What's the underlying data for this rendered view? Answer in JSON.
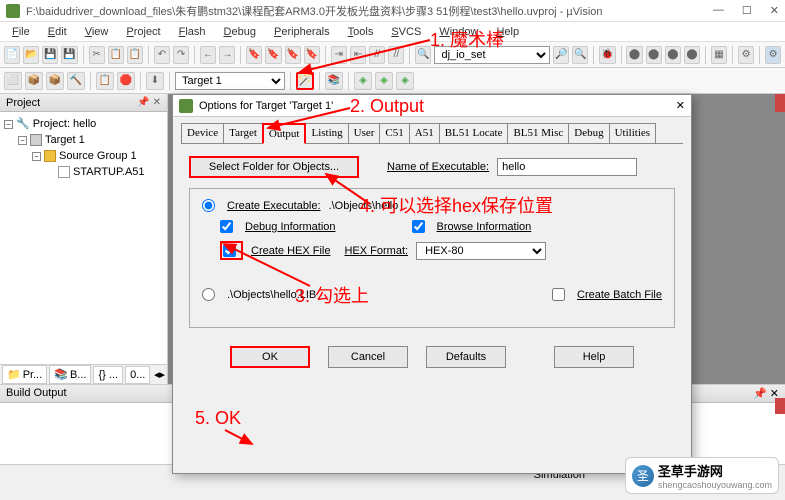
{
  "window": {
    "title": "F:\\baidudriver_download_files\\朱有鹏stm32\\课程配套ARM3.0开发板光盘资料\\步骤3 51例程\\test3\\hello.uvproj - µVision"
  },
  "menu": {
    "file": "File",
    "edit": "Edit",
    "view": "View",
    "project": "Project",
    "flash": "Flash",
    "debug": "Debug",
    "peripherals": "Peripherals",
    "tools": "Tools",
    "svcs": "SVCS",
    "window": "Window",
    "help": "Help"
  },
  "toolbar": {
    "dropdown1": "dj_io_set",
    "target": "Target 1"
  },
  "project_panel": {
    "title": "Project",
    "root": "Project: hello",
    "target": "Target 1",
    "group": "Source Group 1",
    "file": "STARTUP.A51",
    "tab_project": "Pr...",
    "tab_books": "B...",
    "tab_functions": "{} ...",
    "tab_templates": "0..."
  },
  "build_output": {
    "title": "Build Output"
  },
  "statusbar": {
    "text": "Simulation"
  },
  "dialog": {
    "title": "Options for Target 'Target 1'",
    "tabs": {
      "device": "Device",
      "target": "Target",
      "output": "Output",
      "listing": "Listing",
      "user": "User",
      "c51": "C51",
      "a51": "A51",
      "bl51locate": "BL51 Locate",
      "bl51misc": "BL51 Misc",
      "debug": "Debug",
      "utilities": "Utilities"
    },
    "select_folder": "Select Folder for Objects...",
    "name_exe_label": "Name of Executable:",
    "name_exe_value": "hello",
    "create_exe_label": "Create Executable:",
    "create_exe_path": ".\\Objects\\hello",
    "debug_info": "Debug Information",
    "browse_info": "Browse Information",
    "create_hex": "Create HEX File",
    "hex_format_label": "HEX Format:",
    "hex_format_value": "HEX-80",
    "create_lib_path": ".\\Objects\\hello.LIB",
    "create_batch": "Create Batch File",
    "btn_ok": "OK",
    "btn_cancel": "Cancel",
    "btn_defaults": "Defaults",
    "btn_help": "Help"
  },
  "annotations": {
    "a1": "1. 魔术棒",
    "a2": "2. Output",
    "a3": "3. 勾选上",
    "a4": "4. 可以选择hex保存位置",
    "a5": "5. OK"
  },
  "watermark": {
    "name": "圣草手游网",
    "url": "shengcaoshouyouwang.com"
  }
}
